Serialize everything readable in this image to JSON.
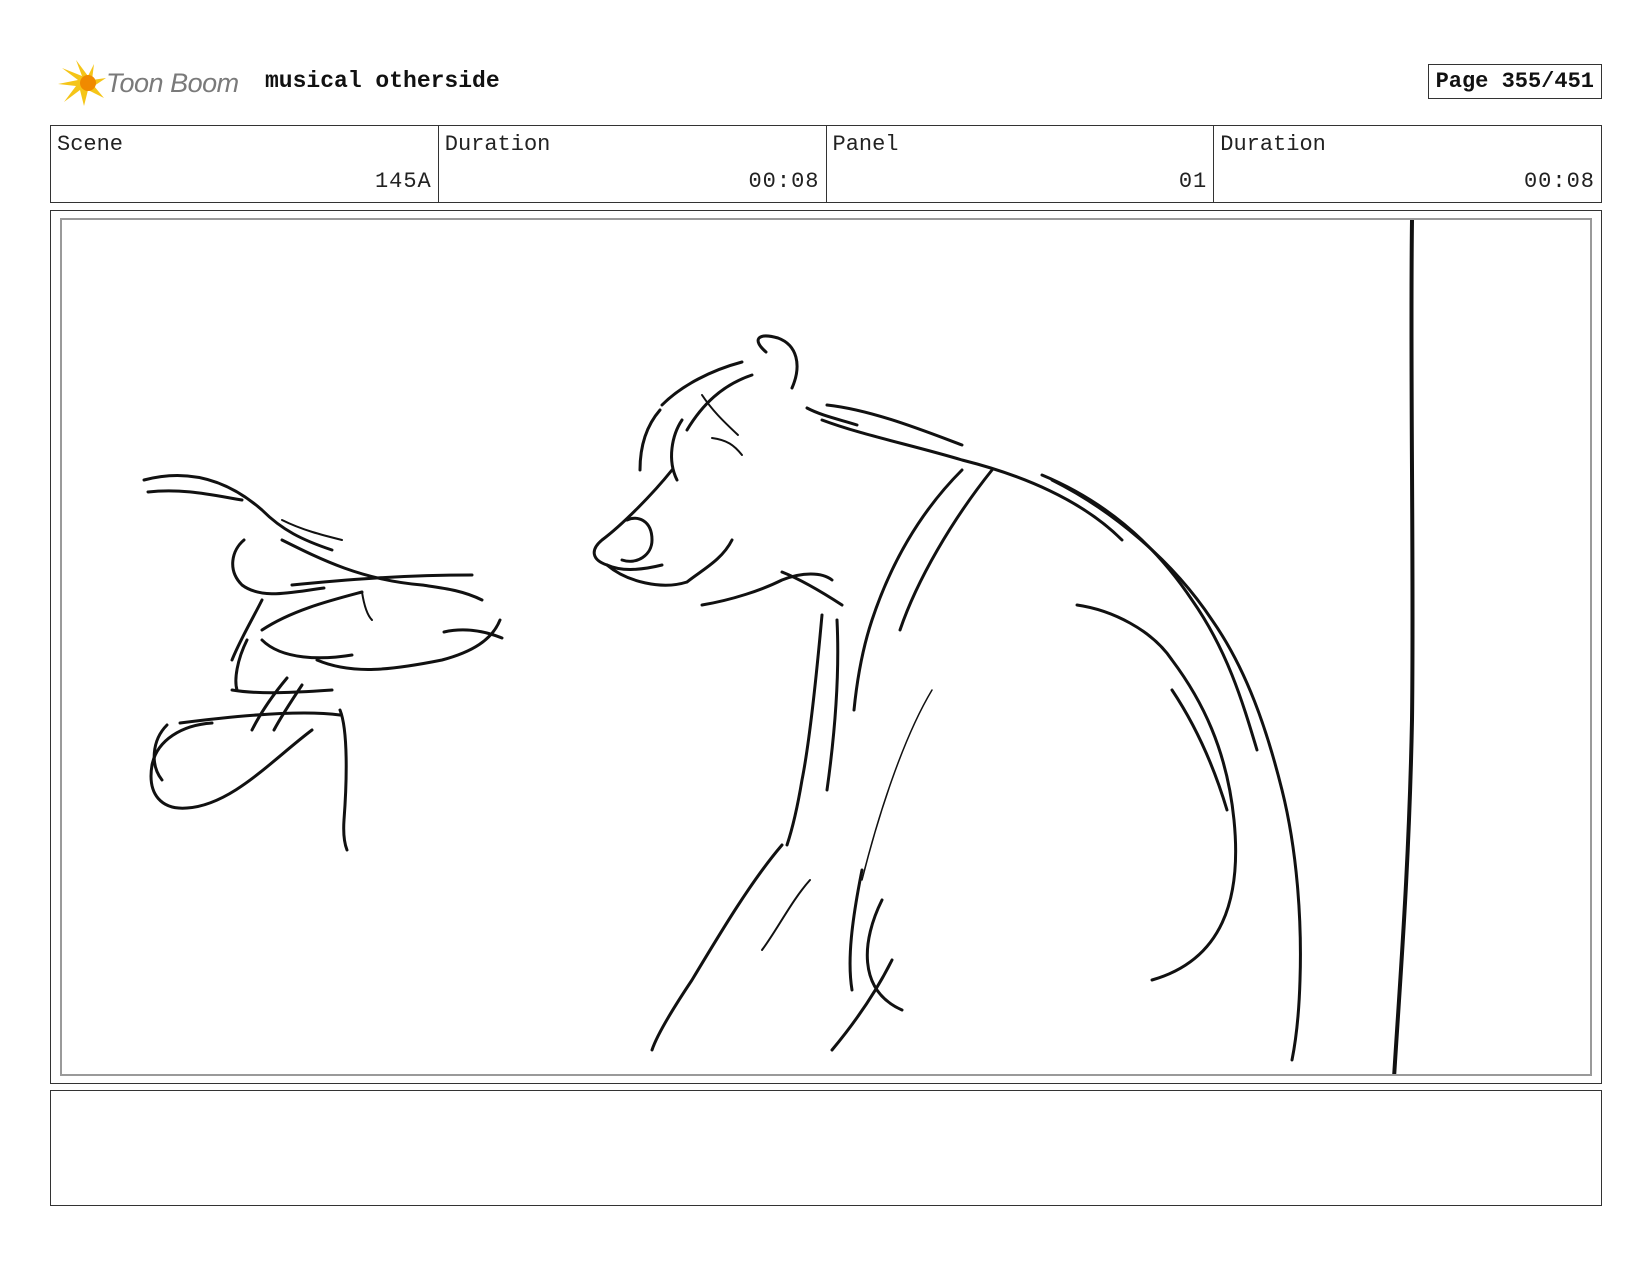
{
  "header": {
    "logo_text": "Toon Boom",
    "project_title": "musical otherside",
    "page_label": "Page 355/451"
  },
  "info": [
    {
      "label": "Scene",
      "value": "145A"
    },
    {
      "label": "Duration",
      "value": "00:08"
    },
    {
      "label": "Panel",
      "value": "01"
    },
    {
      "label": "Duration",
      "value": "00:08"
    }
  ],
  "notes": {
    "text": ""
  },
  "colors": {
    "logo_yellow": "#f5c518",
    "logo_orange": "#f08a00",
    "logo_text_gray": "#7a7a7a",
    "sketch_line": "#111111"
  }
}
